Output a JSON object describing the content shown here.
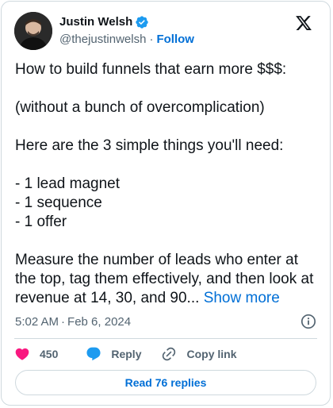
{
  "author": {
    "name": "Justin Welsh",
    "handle": "@thejustinwelsh",
    "separator": "·",
    "follow_label": "Follow",
    "avatar_icon": "profile-photo",
    "verified_icon": "verified-badge-icon",
    "verified_color": "#1d9bf0"
  },
  "platform_logo": "x-logo-icon",
  "tweet": {
    "paragraphs": [
      "How to build funnels that earn more $$$:",
      "(without a bunch of overcomplication)",
      "Here are the 3 simple things you'll need:",
      "- 1 lead magnet\n- 1 sequence\n- 1 offer",
      "Measure the number of leads who enter at the top, tag them effectively, and then look at revenue at 14, 30, and 90..."
    ],
    "show_more_label": "Show more"
  },
  "meta": {
    "time": "5:02 AM",
    "separator": "·",
    "date": "Feb 6, 2024",
    "info_icon": "info-icon"
  },
  "actions": {
    "like_count": "450",
    "like_icon": "heart-icon",
    "like_color": "#f91880",
    "reply_label": "Reply",
    "reply_icon": "reply-bubble-icon",
    "reply_color": "#1d9bf0",
    "copy_label": "Copy link",
    "copy_icon": "link-icon"
  },
  "read_replies_label": "Read 76 replies",
  "colors": {
    "accent": "#006fd6",
    "text": "#0f1419",
    "secondary": "#536471",
    "border": "#cfd9de"
  }
}
